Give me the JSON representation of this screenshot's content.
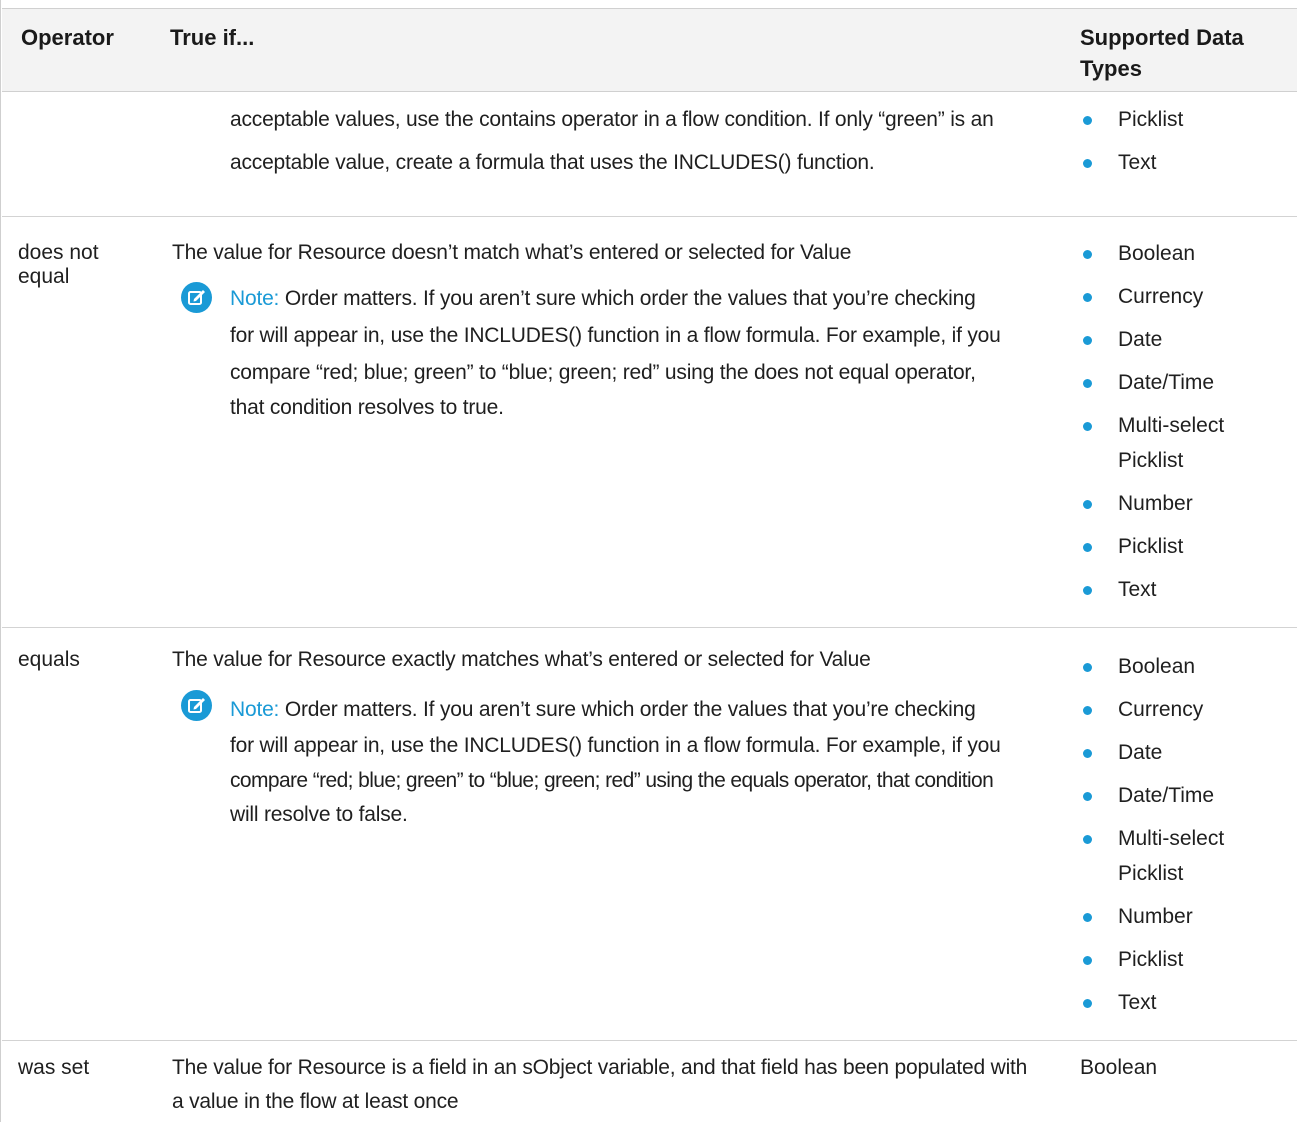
{
  "header": {
    "operator": "Operator",
    "true_if": "True if...",
    "supported_types": "Supported Data Types"
  },
  "rows": [
    {
      "operator": "",
      "lines": [
        "acceptable values, use the contains operator in a flow condition. If only “green” is an",
        "acceptable value, create a formula that uses the INCLUDES() function."
      ],
      "types": [
        "Picklist",
        "Text"
      ]
    },
    {
      "operator_lines": [
        "does not",
        "equal"
      ],
      "description": "The value for Resource doesn’t match what’s entered or selected for Value",
      "note_label": "Note:",
      "note_lines": [
        "Order matters. If you aren’t sure which order the values that you’re checking",
        "for will appear in, use the INCLUDES() function in a flow formula. For example, if you",
        "compare “red; blue; green” to “blue; green; red” using the does not equal operator,",
        "that condition resolves to true."
      ],
      "types": [
        "Boolean",
        "Currency",
        "Date",
        "Date/Time",
        "Multi-select",
        "Picklist",
        "Number",
        "Picklist",
        "Text"
      ]
    },
    {
      "operator": "equals",
      "description": "The value for Resource exactly matches what’s entered or selected for Value",
      "note_label": "Note:",
      "note_lines": [
        "Order matters. If you aren’t sure which order the values that you’re checking",
        "for will appear in, use the INCLUDES() function in a flow formula. For example, if you",
        "compare “red; blue; green” to “blue; green; red” using the equals operator, that condition",
        "will resolve to false."
      ],
      "types": [
        "Boolean",
        "Currency",
        "Date",
        "Date/Time",
        "Multi-select",
        "Picklist",
        "Number",
        "Picklist",
        "Text"
      ]
    },
    {
      "operator": "was set",
      "lines": [
        "The value for Resource is a field in an sObject variable, and that field has been populated with",
        "a value in the flow at least once"
      ],
      "type": "Boolean"
    }
  ],
  "colors": {
    "accent": "#1a9ad6",
    "header_bg": "#f3f3f3",
    "border": "#d3d3d3"
  },
  "icons": {
    "note": "edit-note-icon"
  }
}
